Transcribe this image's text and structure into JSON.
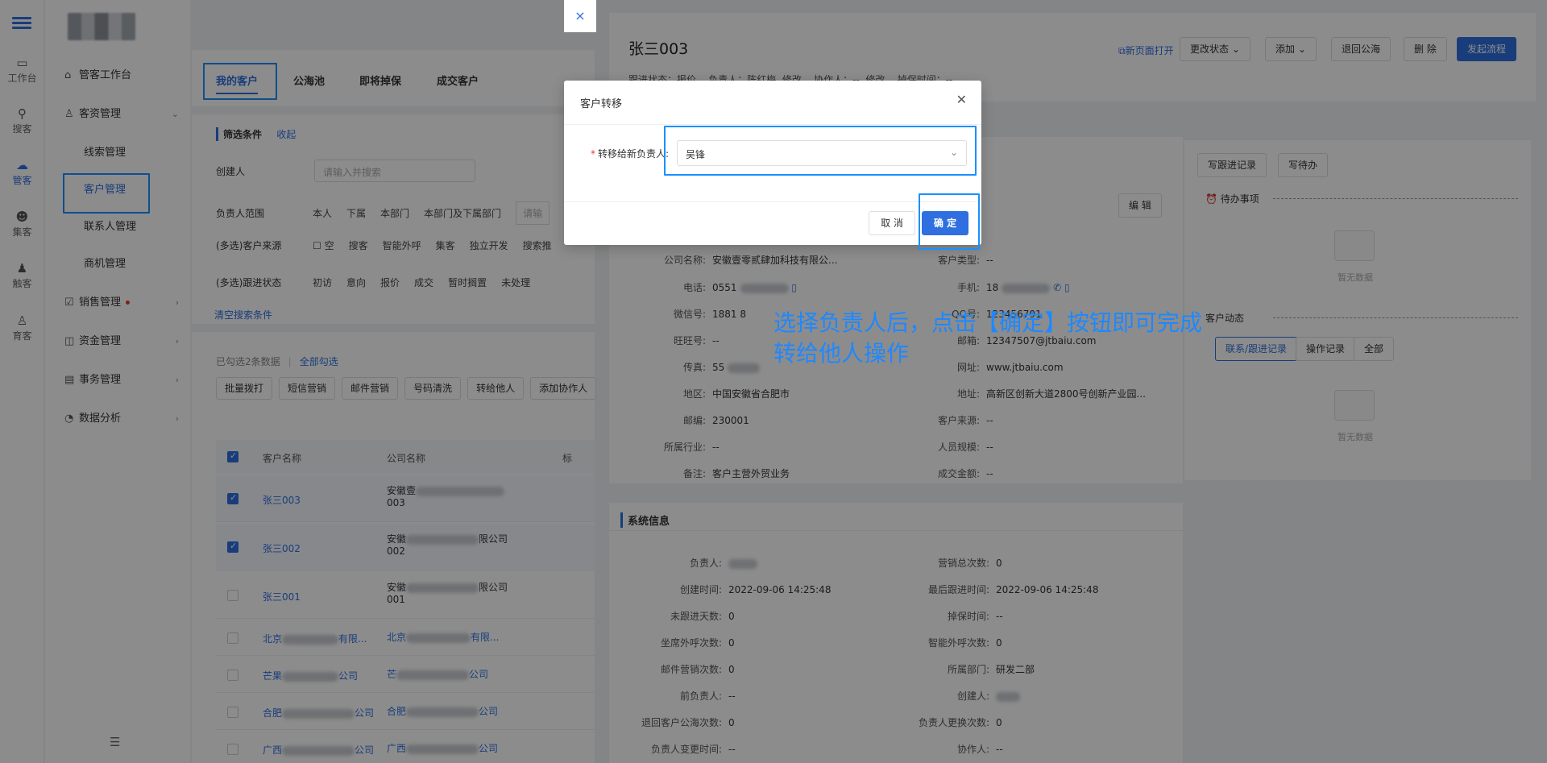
{
  "rail": {
    "items": [
      {
        "label": "工作台",
        "icon": "desktop-icon"
      },
      {
        "label": "搜客",
        "icon": "user-search-icon"
      },
      {
        "label": "管客",
        "icon": "cloud-icon"
      },
      {
        "label": "集客",
        "icon": "users-icon"
      },
      {
        "label": "触客",
        "icon": "user-touch-icon"
      },
      {
        "label": "育客",
        "icon": "user-grow-icon"
      }
    ]
  },
  "sidebar": {
    "items": [
      {
        "label": "管客工作台",
        "icon": "home-icon"
      },
      {
        "label": "客资管理",
        "icon": "user-icon",
        "arrow": "⌄"
      },
      {
        "label": "销售管理",
        "icon": "check-square-icon",
        "arrow": "›"
      },
      {
        "label": "资金管理",
        "icon": "wallet-icon",
        "arrow": "›"
      },
      {
        "label": "事务管理",
        "icon": "calendar-icon",
        "arrow": "›"
      },
      {
        "label": "数据分析",
        "icon": "pie-chart-icon",
        "arrow": "›"
      }
    ],
    "sub": [
      "线索管理",
      "客户管理",
      "联系人管理",
      "商机管理"
    ]
  },
  "list": {
    "tabs": [
      "我的客户",
      "公海池",
      "即将掉保",
      "成交客户"
    ],
    "filter_title": "筛选条件",
    "collapse": "收起",
    "creator_label": "创建人",
    "creator_placeholder": "请输入并搜索",
    "owner_label": "负责人范围",
    "owner_opts": [
      "本人",
      "下属",
      "本部门",
      "本部门及下属部门"
    ],
    "owner_placeholder": "请输",
    "source_label": "(多选)客户来源",
    "source_opts": [
      "空",
      "搜客",
      "智能外呼",
      "集客",
      "独立开发",
      "搜索推"
    ],
    "status_label": "(多选)跟进状态",
    "status_opts": [
      "初访",
      "意向",
      "报价",
      "成交",
      "暂时搁置",
      "未处理"
    ],
    "clear": "清空搜索条件",
    "selected": "已勾选2条数据",
    "select_all": "全部勾选",
    "actions": [
      "批量拨打",
      "短信营销",
      "邮件营销",
      "号码清洗",
      "转给他人",
      "添加协作人"
    ],
    "col_name": "客户名称",
    "col_company": "公司名称",
    "col_tag": "标",
    "rows": [
      {
        "name": "张三003",
        "company": "安徽壹",
        "suffix": "003",
        "checked": true
      },
      {
        "name": "张三002",
        "company": "安徽",
        "suffix": "002",
        "tail": "限公司",
        "checked": true
      },
      {
        "name": "张三001",
        "company": "安徽",
        "suffix": "001",
        "tail": "限公司",
        "checked": false
      },
      {
        "name": "北京",
        "company": "北京",
        "tail": "有限...",
        "checked": false
      },
      {
        "name": "芒果",
        "company": "芒",
        "tail": "公司",
        "checked": false
      },
      {
        "name": "合肥",
        "company": "合肥",
        "tail": "公司",
        "checked": false
      },
      {
        "name": "广西",
        "company": "广西",
        "tail": "公司",
        "checked": false
      }
    ]
  },
  "drawer": {
    "close": "×",
    "title": "张三003",
    "meta": "跟进状态：报价    负责人：陈红梅  修改    协作人：--  修改    掉保时间：--",
    "new_page": "新页面打开",
    "buttons": [
      "更改状态 ⌄",
      "添加 ⌄",
      "退回公海",
      "删 除",
      "发起流程"
    ],
    "edit": "编 辑",
    "left_fields": [
      {
        "k": "公司名称:",
        "v": "安徽壹零贰肆加科技有限公..."
      },
      {
        "k": "电话:",
        "v": "0551"
      },
      {
        "k": "微信号:",
        "v": "1881 8"
      },
      {
        "k": "旺旺号:",
        "v": "--"
      },
      {
        "k": "传真:",
        "v": "55"
      },
      {
        "k": "地区:",
        "v": "中国安徽省合肥市"
      },
      {
        "k": "邮编:",
        "v": "230001"
      },
      {
        "k": "所属行业:",
        "v": "--"
      },
      {
        "k": "备注:",
        "v": "客户主营外贸业务"
      }
    ],
    "right_fields": [
      {
        "k": "客户类型:",
        "v": "--"
      },
      {
        "k": "手机:",
        "v": "18"
      },
      {
        "k": "QQ号:",
        "v": "123456791"
      },
      {
        "k": "邮箱:",
        "v": "12347507@jtbaiu.com"
      },
      {
        "k": "网址:",
        "v": "www.jtbaiu.com"
      },
      {
        "k": "地址:",
        "v": "高新区创新大道2800号创新产业园..."
      },
      {
        "k": "客户来源:",
        "v": "--"
      },
      {
        "k": "人员规模:",
        "v": "--"
      },
      {
        "k": "成交金额:",
        "v": "--"
      }
    ],
    "sys_title": "系统信息",
    "sys_left": [
      {
        "k": "负责人:",
        "v": ""
      },
      {
        "k": "创建时间:",
        "v": "2022-09-06 14:25:48"
      },
      {
        "k": "未跟进天数:",
        "v": "0"
      },
      {
        "k": "坐席外呼次数:",
        "v": "0"
      },
      {
        "k": "邮件营销次数:",
        "v": "0"
      },
      {
        "k": "前负责人:",
        "v": "--"
      },
      {
        "k": "退回客户公海次数:",
        "v": "0"
      },
      {
        "k": "负责人变更时间:",
        "v": "--"
      }
    ],
    "sys_right": [
      {
        "k": "营销总次数:",
        "v": "0"
      },
      {
        "k": "最后跟进时间:",
        "v": "2022-09-06 14:25:48"
      },
      {
        "k": "掉保时间:",
        "v": "--"
      },
      {
        "k": "智能外呼次数:",
        "v": "0"
      },
      {
        "k": "所属部门:",
        "v": "研发二部"
      },
      {
        "k": "创建人:",
        "v": ""
      },
      {
        "k": "负责人更换次数:",
        "v": "0"
      },
      {
        "k": "协作人:",
        "v": "--"
      }
    ],
    "right_btns": [
      "写跟进记录",
      "写待办"
    ],
    "todo": "待办事项",
    "empty": "暂无数据",
    "activity": "客户动态",
    "activity_tabs": [
      "联系/跟进记录",
      "操作记录",
      "全部"
    ]
  },
  "modal": {
    "title": "客户转移",
    "label": "转移给新负责人:",
    "value": "吴锋",
    "cancel": "取 消",
    "ok": "确 定"
  },
  "annotation": {
    "line1": "选择负责人后，点击【确定】按钮即可完成",
    "line2": "转给他人操作"
  },
  "colors": {
    "accent": "#2f6fe0",
    "highlight": "#1890ff",
    "annotation": "#1e88ff"
  }
}
